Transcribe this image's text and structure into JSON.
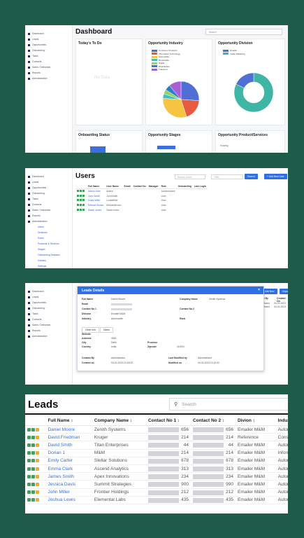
{
  "panel1": {
    "title": "Dashboard",
    "selector": "Search",
    "sidebar": [
      "Dashboard",
      "Leads",
      "Opportunities",
      "Onboarding",
      "Tasks",
      "Contacts",
      "Sales / Deliveries",
      "Reports",
      "Administration"
    ],
    "cards": {
      "todo": "Today's To Do",
      "todo_empty": "No Data",
      "industry": "Opportunity Industry",
      "division": "Opportunity Division",
      "onboarding": "Onboarding Status",
      "stages": "Opportunity Stages",
      "product": "Opportunity Product/Services",
      "product_row": "Hosting"
    },
    "industry_legend": [
      "Consumer Products",
      "Information Technology",
      "Automobile",
      "Renewable",
      "Digital",
      "Real Estate",
      "Transport"
    ],
    "division_legend": [
      "Emailer",
      "Inside Marketing"
    ]
  },
  "panel2": {
    "title": "Users",
    "search_placeholder": "Search Users",
    "filter_placeholder": "Filter",
    "search_button": "Search",
    "add_button": "+ Add New User",
    "sidebar": [
      "Dashboard",
      "Leads",
      "Opportunities",
      "Onboarding",
      "Tasks",
      "Contacts",
      "Sales / Deliveries",
      "Reports",
      "Administration",
      "Users",
      "Divisions",
      "Roles",
      "Products & Services",
      "Stages",
      "Onboarding Statuses",
      "Industry",
      "Settings"
    ],
    "columns": [
      "Full Name",
      "User Name",
      "Email",
      "Contact No",
      "Manager",
      "Role",
      "Onboarding",
      "Last Login"
    ],
    "rows": [
      [
        "Admin User",
        "Admin",
        "",
        "",
        "",
        "Administrator",
        "",
        ""
      ],
      [
        "John Smith",
        "JohnSmith",
        "",
        "",
        "",
        "User",
        "",
        ""
      ],
      [
        "Linda Miller",
        "LindaMiller",
        "",
        "",
        "",
        "User",
        "",
        ""
      ],
      [
        "Michael Brown",
        "MichaelBrown",
        "",
        "",
        "",
        "User",
        "",
        ""
      ],
      [
        "Sarah Jones",
        "SarahJones",
        "",
        "",
        "",
        "User",
        "",
        ""
      ]
    ]
  },
  "panel3": {
    "modal_title": "Leads Details",
    "close": "×",
    "add_button": "+ Add New",
    "import_button": "Import",
    "col_created_by": "Created By",
    "col_created_on": "Created On",
    "right_rows": [
      [
        "Administrator",
        "04.01.2023 10:15"
      ],
      [
        "Administrator",
        "04.01.2023 10:20"
      ]
    ],
    "sidebar": [
      "Dashboard",
      "Leads",
      "Opportunities",
      "Onboarding",
      "Tasks",
      "Contacts",
      "Sales / Deliveries",
      "Reports",
      "Administration"
    ],
    "fields_left": [
      [
        "Full Name",
        "Daniel Moore"
      ],
      [
        "Email",
        ""
      ],
      [
        "Contact No 1",
        ""
      ],
      [
        "Division",
        "Emailer M&M"
      ],
      [
        "Industry",
        "Automobile"
      ]
    ],
    "fields_right": [
      [
        "Company Name",
        "Zenith Systems"
      ],
      [
        "Contact No 2",
        ""
      ],
      [
        "Rank",
        ""
      ]
    ],
    "tabs": [
      "Other Info",
      "Notes"
    ],
    "address_fields": [
      [
        "Website",
        ""
      ],
      [
        "Address",
        "4562"
      ],
      [
        "City",
        "Delhi"
      ],
      [
        "Country",
        "India"
      ]
    ],
    "address_right": [
      [
        "Province",
        ""
      ],
      [
        "Zipcode",
        "110001"
      ]
    ],
    "footer": [
      [
        "Created By",
        "Administrator"
      ],
      [
        "Created on",
        "04.01.2023 10:15:32"
      ],
      [
        "Last Modified by",
        "Administrator"
      ],
      [
        "Modified on",
        "04.01.2023 10:15:32"
      ]
    ]
  },
  "panel4": {
    "title": "Leads",
    "search_placeholder": "Search",
    "columns": [
      "Full Name",
      "Company Name",
      "Contact No 1",
      "Contact No 2",
      "Divion",
      "Industry"
    ],
    "rows": [
      [
        "Daniel Moore",
        "Zenith Systems",
        "656",
        "656",
        "Emailer M&M",
        "Automobile"
      ],
      [
        "David Friedman",
        "Kruger",
        "214",
        "214",
        "Reference",
        "Consumer Pro"
      ],
      [
        "David Smith",
        "Titan Enterprises",
        "44",
        "44",
        "Emailer M&M",
        "Automobile"
      ],
      [
        "Dorian 1",
        "M&M",
        "214",
        "214",
        "Emailer M&M",
        "Information Te"
      ],
      [
        "Emily Carter",
        "Stellar Solutions",
        "678",
        "678",
        "Emailer M&M",
        "Automobile"
      ],
      [
        "Emma Clark",
        "Ascend Analytics",
        "313",
        "313",
        "Emailer M&M",
        "Automobile"
      ],
      [
        "James Smith",
        "Apex Innovations",
        "234",
        "234",
        "Emailer M&M",
        "Automobile"
      ],
      [
        "Jessica Davis",
        "Summit Strategies",
        "900",
        "990",
        "Emailer M&M",
        "Automobile"
      ],
      [
        "John Miller",
        "Frontier Holdings",
        "212",
        "212",
        "Emailer M&M",
        "Automobile"
      ],
      [
        "Joshua Lewis",
        "Elemental Labs",
        "435",
        "435",
        "Emailer M&M",
        "Automobile"
      ]
    ]
  },
  "colors": {
    "background": "#1f5b49",
    "accent": "#2f6fe4",
    "link": "#3b6fd4"
  },
  "chart_data": [
    {
      "type": "pie",
      "title": "Opportunity Industry",
      "categories": [
        "Consumer Products",
        "Information Technology",
        "Automobile",
        "Renewable",
        "Digital",
        "Real Estate",
        "Transport"
      ],
      "values": [
        26,
        19,
        31,
        4,
        4,
        5,
        11
      ],
      "colors": [
        "#4f6fd6",
        "#e85a3f",
        "#f6c342",
        "#3fbfbf",
        "#8ed36b",
        "#2d7fc7",
        "#a560d8"
      ]
    },
    {
      "type": "pie",
      "title": "Opportunity Division",
      "categories": [
        "Emailer",
        "Inside Marketing"
      ],
      "values": [
        82,
        18
      ],
      "colors": [
        "#3fb5a6",
        "#4f6fd6"
      ]
    }
  ]
}
